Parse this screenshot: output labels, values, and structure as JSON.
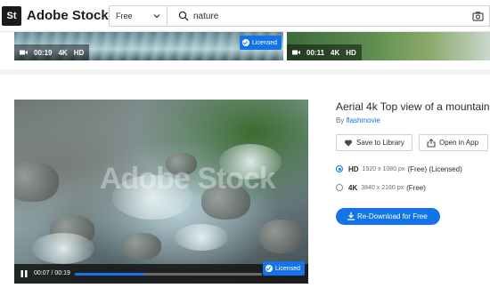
{
  "header": {
    "logo_badge": "St",
    "logo_text": "Adobe Stock",
    "filter_value": "Free",
    "search_value": "nature"
  },
  "top_thumbs": [
    {
      "duration": "00:19",
      "quality_1": "4K",
      "quality_2": "HD",
      "licensed": "Licensed"
    },
    {
      "duration": "00:11",
      "quality_1": "4K",
      "quality_2": "HD"
    }
  ],
  "preview": {
    "current_time": "00:07",
    "separator": "/",
    "total_time": "00:19",
    "progress": 0.37,
    "licensed": "Licensed",
    "watermark": "Adobe Stock"
  },
  "detail": {
    "title": "Aerial 4k Top view of a mountain",
    "by_label": "By",
    "author": "flashmovie",
    "save_label": "Save to Library",
    "open_label": "Open in App",
    "options": [
      {
        "tag": "HD",
        "px": "1920 x 1080 px",
        "note": "(Free) (Licensed)",
        "checked": true
      },
      {
        "tag": "4K",
        "px": "3840 x 2160 px",
        "note": "(Free)",
        "checked": false
      }
    ],
    "download_label": "Re-Download for Free"
  },
  "colors": {
    "accent": "#1473e6",
    "text": "#2c2c2c"
  }
}
